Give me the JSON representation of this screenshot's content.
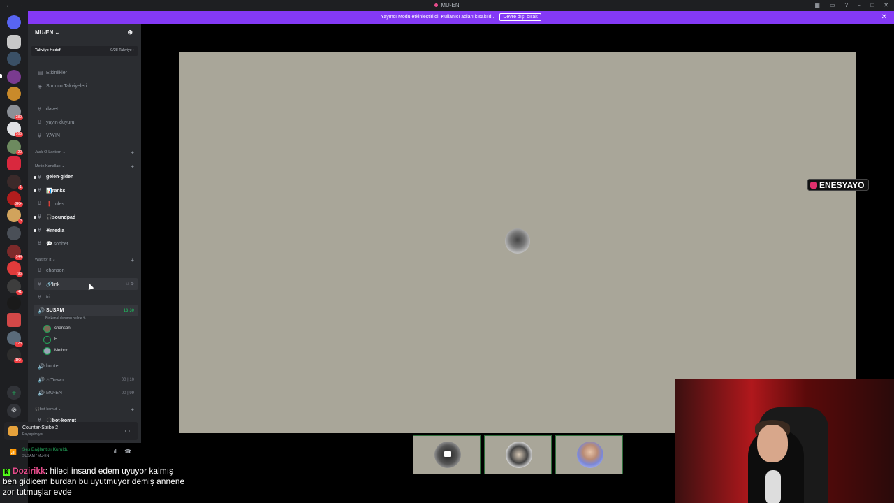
{
  "window": {
    "title": "MU-EN"
  },
  "banner": {
    "text": "Yayıncı Modu etkinleştirildi. Kullanıcı adları kısaltıldı.",
    "button": "Devre dışı bırak"
  },
  "guild": {
    "name": "MU-EN ⌄",
    "boost_label": "Takviye Hedefi",
    "boost_progress": "0/28 Takviye ›",
    "top_items": [
      {
        "label": "Etkinlikler",
        "icon": "calendar-icon"
      },
      {
        "label": "Sunucu Takviyeleri",
        "icon": "boost-icon"
      }
    ],
    "channels_a": [
      {
        "label": "davet"
      },
      {
        "label": "yayın-duyuru"
      },
      {
        "label": "YAYIN"
      }
    ],
    "cat_jack": "Jack-O-Lantern ⌄",
    "cat_text": "Metin Kanalları ⌄",
    "text_channels": [
      {
        "label": "gelen-giden"
      },
      {
        "label": "📊ranks"
      },
      {
        "label": "❗ rules"
      },
      {
        "label": "🎧soundpad"
      },
      {
        "label": "✳media"
      },
      {
        "label": "💬 sohbet"
      }
    ],
    "cat_wait": "Wait for It ⌄",
    "wait_channels": [
      {
        "label": "chanson"
      },
      {
        "label": "🔗link"
      },
      {
        "label": "tri"
      }
    ],
    "voice_active": {
      "label": "SUSAM",
      "time": "13:30",
      "status": "Bir kanal durumu belirle ✎"
    },
    "voice_members": [
      {
        "name": "chanson"
      },
      {
        "name": "E..."
      },
      {
        "name": "Method"
      }
    ],
    "voice_channels": [
      {
        "label": "hunter",
        "trail": ""
      },
      {
        "label": "♨To-wn",
        "trail": "00 | 10"
      },
      {
        "label": "MU-EN",
        "trail": "00 | 99"
      }
    ],
    "cat_bot": "🎧bot-komut ⌄",
    "bot_channel": "🎧bot-komut"
  },
  "activity": {
    "name": "Counter-Strike 2",
    "sub": "Paylaşılmıyor"
  },
  "voice": {
    "status": "Ses Bağlantısı Kuruldu",
    "sub": "SUSAM / MU-EN"
  },
  "overlay": {
    "tag": "ENESYAYO"
  },
  "chat": {
    "user": "Dozirikk",
    "line1": ": hileci insand edem uyuyor kalmış",
    "line2": "ben gidicem burdan bu uyutmuyor demiş annene",
    "line3": "zor tutmuşlar evde"
  },
  "servers": {
    "badges": [
      "2",
      "289",
      "165",
      "20",
      "1",
      "2K+",
      "8",
      "144",
      "95",
      "41",
      "128",
      "1K+"
    ]
  }
}
